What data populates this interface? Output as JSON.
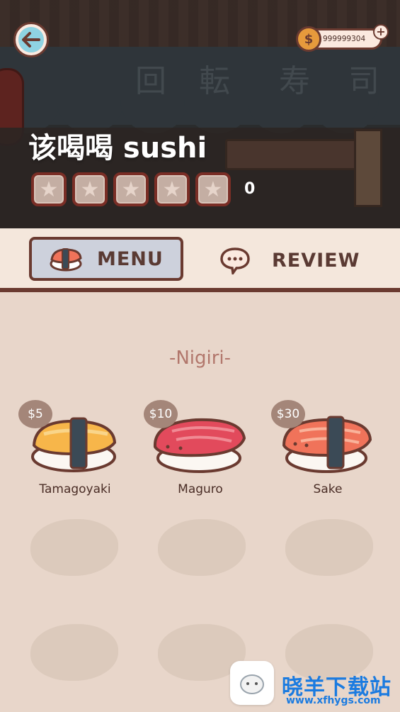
{
  "header": {
    "title": "该喝喝 sushi",
    "coins": "999999304",
    "review_count": "0",
    "stars_filled": 0,
    "stars_total": 5,
    "awning_text": [
      "回",
      "転",
      "寿",
      "司"
    ]
  },
  "tabs": [
    {
      "label": "MENU",
      "icon": "sushi-icon",
      "selected": true
    },
    {
      "label": "REVIEW",
      "icon": "speech-bubble-icon",
      "selected": false
    }
  ],
  "menu": {
    "section_title": "-Nigiri-",
    "items": [
      {
        "name": "Tamagoyaki",
        "price": "$5"
      },
      {
        "name": "Maguro",
        "price": "$10"
      },
      {
        "name": "Sake",
        "price": "$30"
      }
    ]
  },
  "watermark": {
    "title": "晓羊下载站",
    "url": "www.xfhygs.com"
  },
  "colors": {
    "background": "#e8d6ca",
    "accent_border": "#6a3a30",
    "price_badge": "#a48679",
    "section_title": "#b2776c",
    "tab_selected": "#cdd1dc",
    "watermark": "#1b7be0"
  }
}
